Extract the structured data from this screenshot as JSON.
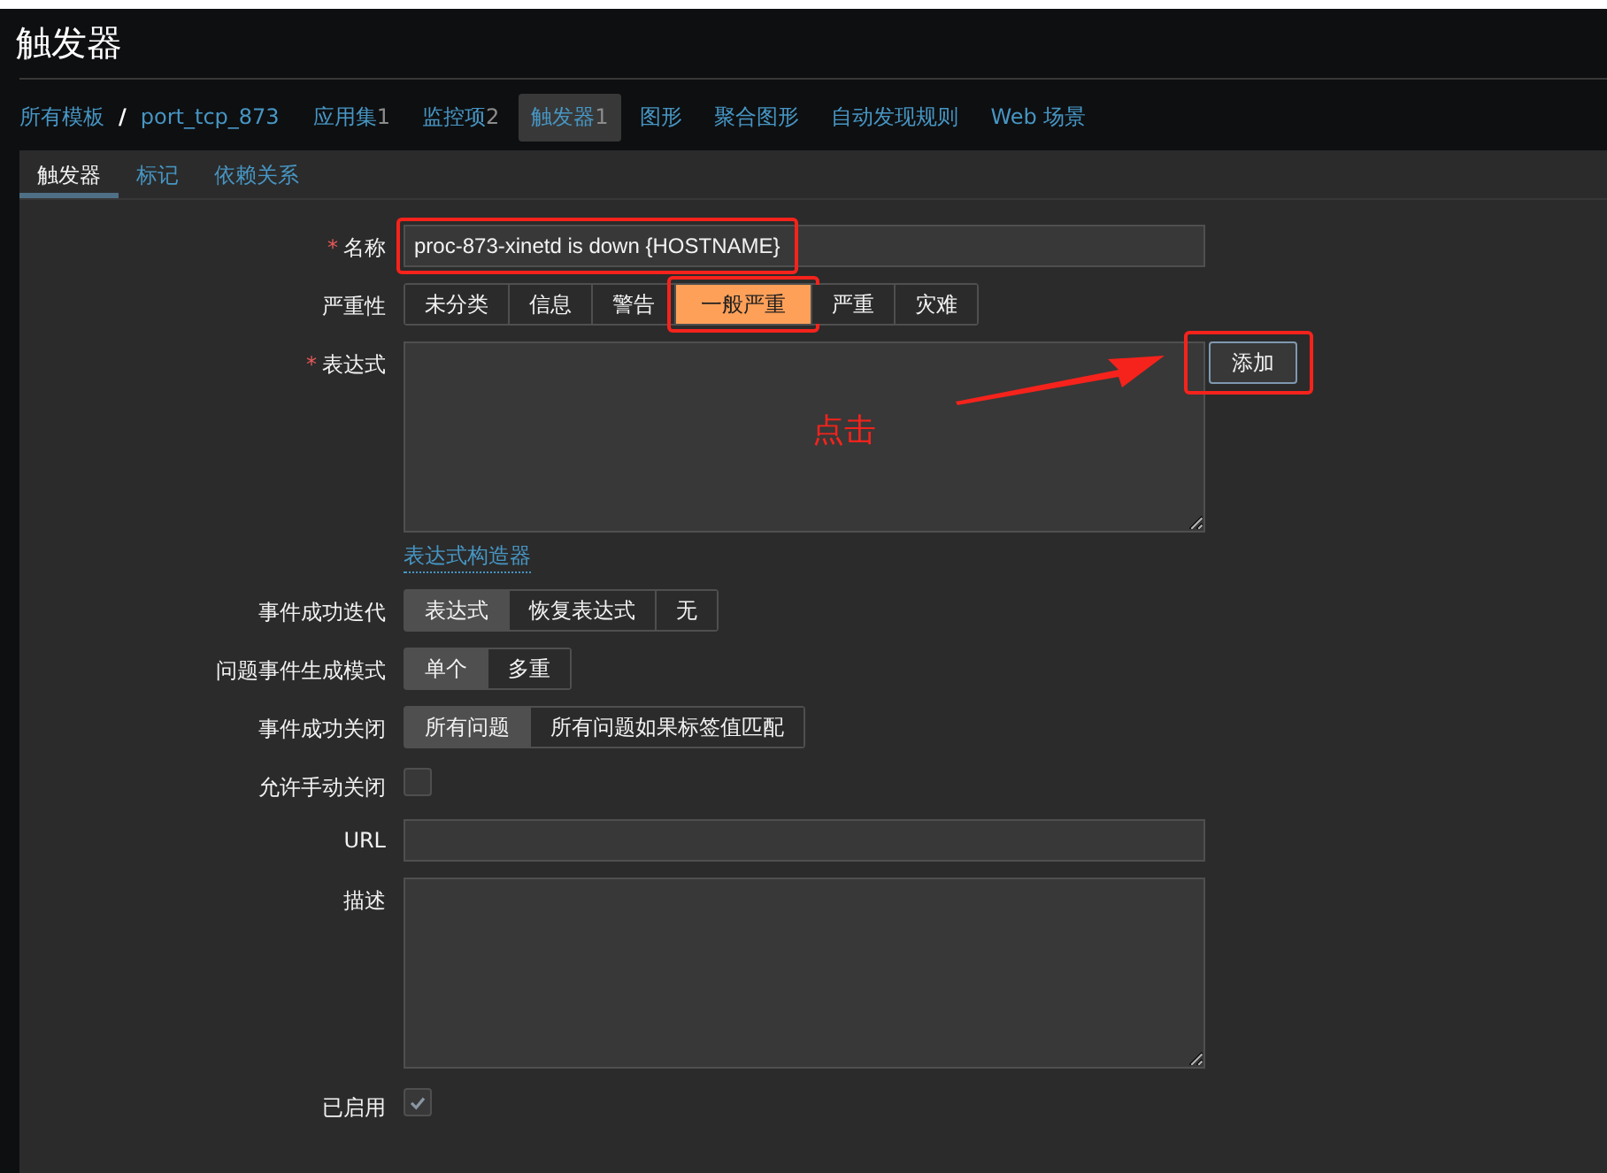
{
  "page_title": "触发器",
  "breadcrumb": {
    "items": [
      {
        "label": "所有模板"
      },
      {
        "label": "port_tcp_873"
      }
    ],
    "separator": "/"
  },
  "nav_tabs": [
    {
      "label": "应用集",
      "count": "1",
      "selected": false
    },
    {
      "label": "监控项",
      "count": "2",
      "selected": false
    },
    {
      "label": "触发器",
      "count": "1",
      "selected": true
    },
    {
      "label": "图形",
      "selected": false
    },
    {
      "label": "聚合图形",
      "selected": false
    },
    {
      "label": "自动发现规则",
      "selected": false
    },
    {
      "label": "Web 场景",
      "selected": false
    }
  ],
  "required_mark": "*",
  "sub_tabs": [
    {
      "label": "触发器",
      "selected": true
    },
    {
      "label": "标记",
      "selected": false
    },
    {
      "label": "依赖关系",
      "selected": false
    }
  ],
  "form": [
    {
      "kind": "text",
      "label": "名称",
      "required": true,
      "value": "proc-873-xinetd is down {HOSTNAME}",
      "highlighted": true
    },
    {
      "kind": "severity",
      "label": "严重性",
      "required": false,
      "options": [
        {
          "label": "未分类",
          "selected": false,
          "highlighted": false
        },
        {
          "label": "信息",
          "selected": false,
          "highlighted": false
        },
        {
          "label": "警告",
          "selected": false,
          "highlighted": false
        },
        {
          "label": "一般严重",
          "selected": true,
          "highlighted": true
        },
        {
          "label": "严重",
          "selected": false,
          "highlighted": false
        },
        {
          "label": "灾难",
          "selected": false,
          "highlighted": false
        }
      ]
    },
    {
      "kind": "expression",
      "label": "表达式",
      "required": true,
      "button": "添加",
      "button_highlighted": true,
      "link": "表达式构造器",
      "note": "点击"
    },
    {
      "kind": "segmented",
      "label": "事件成功迭代",
      "required": false,
      "options": [
        {
          "label": "表达式",
          "selected": true,
          "highlighted": false
        },
        {
          "label": "恢复表达式",
          "selected": false,
          "highlighted": false
        },
        {
          "label": "无",
          "selected": false,
          "highlighted": false
        }
      ]
    },
    {
      "kind": "segmented",
      "label": "问题事件生成模式",
      "required": false,
      "options": [
        {
          "label": "单个",
          "selected": true,
          "highlighted": false
        },
        {
          "label": "多重",
          "selected": false,
          "highlighted": false
        }
      ]
    },
    {
      "kind": "segmented",
      "label": "事件成功关闭",
      "required": false,
      "options": [
        {
          "label": "所有问题",
          "selected": true,
          "highlighted": false
        },
        {
          "label": "所有问题如果标签值匹配",
          "selected": false,
          "highlighted": false
        }
      ]
    },
    {
      "kind": "checkbox",
      "label": "允许手动关闭",
      "required": false,
      "checked": false
    },
    {
      "kind": "text",
      "label": "URL",
      "required": false
    },
    {
      "kind": "textarea",
      "label": "描述",
      "required": false
    },
    {
      "kind": "checkbox",
      "label": "已启用",
      "required": false,
      "checked": true
    }
  ]
}
